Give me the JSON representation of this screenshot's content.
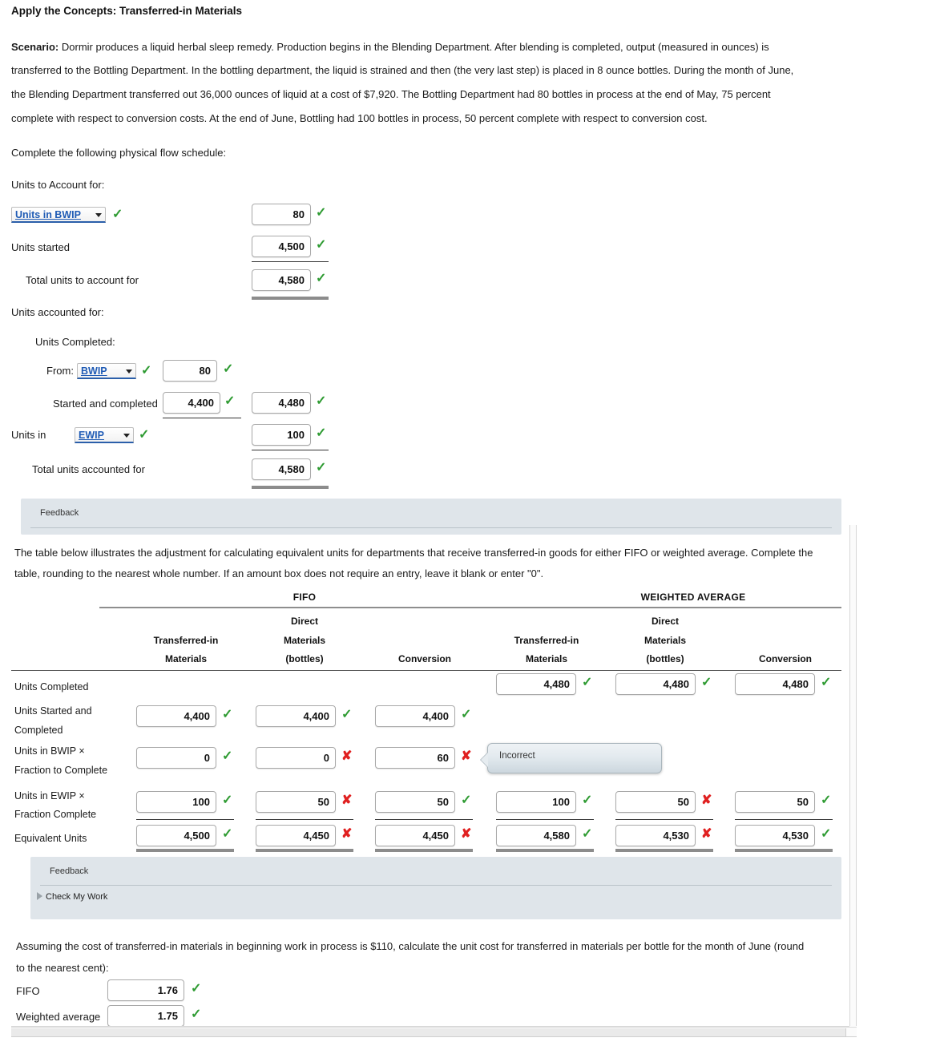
{
  "title": "Apply the Concepts: Transferred-in Materials",
  "scenario": {
    "label": "Scenario:",
    "lines": [
      "Dormir produces a liquid herbal sleep remedy. Production begins in the Blending Department. After blending is completed, output (measured in ounces) is",
      "transferred to the Bottling Department. In the bottling department, the liquid is strained and then (the very last step) is placed in 8 ounce bottles. During the month of June,",
      "the Blending Department transferred out 36,000 ounces of liquid at a cost of $7,920. The Bottling Department had 80 bottles in process at the end of May, 75 percent",
      "complete with respect to conversion costs. At the end of June, Bottling had 100 bottles in process, 50 percent complete with respect to conversion cost."
    ]
  },
  "instruction_flow": "Complete the following physical flow schedule:",
  "flow": {
    "units_to_account_heading": "Units to Account for:",
    "rows": [
      {
        "label": "Units in BWIP",
        "is_dropdown": true,
        "dropdown_status": "ok",
        "value": "80",
        "status": "ok"
      },
      {
        "label": "Units started",
        "is_dropdown": false,
        "value": "4,500",
        "status": "ok"
      },
      {
        "label": "Total units to account for",
        "is_dropdown": false,
        "value": "4,580",
        "status": "ok"
      }
    ],
    "units_accounted_heading": "Units accounted for:",
    "units_completed_heading": "Units Completed:",
    "from_label": "From:",
    "from_dropdown": "BWIP",
    "from_dropdown_status": "ok",
    "from_value": "80",
    "from_value_status": "ok",
    "started_completed_label": "Started and completed",
    "started_completed_value": "4,400",
    "started_completed_status": "ok",
    "started_completed_value2": "4,480",
    "started_completed_status2": "ok",
    "units_in_label": "Units in",
    "ewip_dropdown": "EWIP",
    "ewip_dropdown_status": "ok",
    "ewip_value": "100",
    "ewip_status": "ok",
    "total_accounted_label": "Total units accounted for",
    "total_accounted_value": "4,580",
    "total_accounted_status": "ok"
  },
  "feedback_top": {
    "label": "Feedback"
  },
  "table_intro": {
    "line1": "The table below illustrates the adjustment for calculating equivalent units for departments that receive transferred-in goods for either FIFO or weighted average. Complete the",
    "line2": "table, rounding to the nearest whole number. If an amount box does not require an entry, leave it blank or enter \"0\"."
  },
  "table": {
    "group_headers": [
      {
        "label": "FIFO"
      },
      {
        "label": "WEIGHTED AVERAGE"
      }
    ],
    "columns": [
      {
        "line1": "",
        "line2": "Transferred-in",
        "line3": "Materials"
      },
      {
        "line1": "Direct",
        "line2": "Materials",
        "line3": "(bottles)"
      },
      {
        "line1": "",
        "line2": "",
        "line3": "Conversion"
      },
      {
        "line1": "",
        "line2": "Transferred-in",
        "line3": "Materials"
      },
      {
        "line1": "Direct",
        "line2": "Materials",
        "line3": "(bottles)"
      },
      {
        "line1": "",
        "line2": "",
        "line3": "Conversion"
      }
    ],
    "rows": [
      {
        "label_line1": "Units Completed",
        "label_line2": "",
        "cells": [
          {
            "value": null,
            "status": null
          },
          {
            "value": null,
            "status": null
          },
          {
            "value": null,
            "status": null
          },
          {
            "value": "4,480",
            "status": "ok"
          },
          {
            "value": "4,480",
            "status": "ok"
          },
          {
            "value": "4,480",
            "status": "ok"
          }
        ]
      },
      {
        "label_line1": "Units Started and",
        "label_line2": "Completed",
        "cells": [
          {
            "value": "4,400",
            "status": "ok"
          },
          {
            "value": "4,400",
            "status": "ok"
          },
          {
            "value": "4,400",
            "status": "ok"
          },
          {
            "value": null,
            "status": null
          },
          {
            "value": null,
            "status": null
          },
          {
            "value": null,
            "status": null
          }
        ]
      },
      {
        "label_line1": "Units in BWIP ×",
        "label_line2": "Fraction to Complete",
        "cells": [
          {
            "value": "0",
            "status": "ok"
          },
          {
            "value": "0",
            "status": "bad"
          },
          {
            "value": "60",
            "status": "bad"
          },
          {
            "value": null,
            "status": null
          },
          {
            "value": null,
            "status": null
          },
          {
            "value": null,
            "status": null
          }
        ]
      },
      {
        "label_line1": "Units in EWIP ×",
        "label_line2": "Fraction Complete",
        "cells": [
          {
            "value": "100",
            "status": "ok"
          },
          {
            "value": "50",
            "status": "bad"
          },
          {
            "value": "50",
            "status": "ok"
          },
          {
            "value": "100",
            "status": "ok"
          },
          {
            "value": "50",
            "status": "bad"
          },
          {
            "value": "50",
            "status": "ok"
          }
        ]
      },
      {
        "label_line1": "Equivalent Units",
        "label_line2": "",
        "cells": [
          {
            "value": "4,500",
            "status": "ok"
          },
          {
            "value": "4,450",
            "status": "bad"
          },
          {
            "value": "4,450",
            "status": "bad"
          },
          {
            "value": "4,580",
            "status": "ok"
          },
          {
            "value": "4,530",
            "status": "bad"
          },
          {
            "value": "4,530",
            "status": "ok"
          }
        ]
      }
    ]
  },
  "tooltip": {
    "text": "Incorrect"
  },
  "feedback_bottom": {
    "label": "Feedback",
    "check_my_work": "Check My Work"
  },
  "final": {
    "line1": "Assuming the cost of transferred-in materials in beginning work in process is $110, calculate the unit cost for transferred in materials per bottle for the month of June (round",
    "line2": "to the nearest cent):",
    "rows": [
      {
        "label": "FIFO",
        "value": "1.76",
        "status": "ok"
      },
      {
        "label": "Weighted average",
        "value": "1.75",
        "status": "ok"
      }
    ]
  },
  "icons": {
    "ok": "✓",
    "bad": "✘"
  },
  "colors": {
    "ok": "#2e9b32",
    "bad": "#e02020",
    "dropdown": "#1f5bb5",
    "feedback_bg": "#dfe5ea"
  }
}
